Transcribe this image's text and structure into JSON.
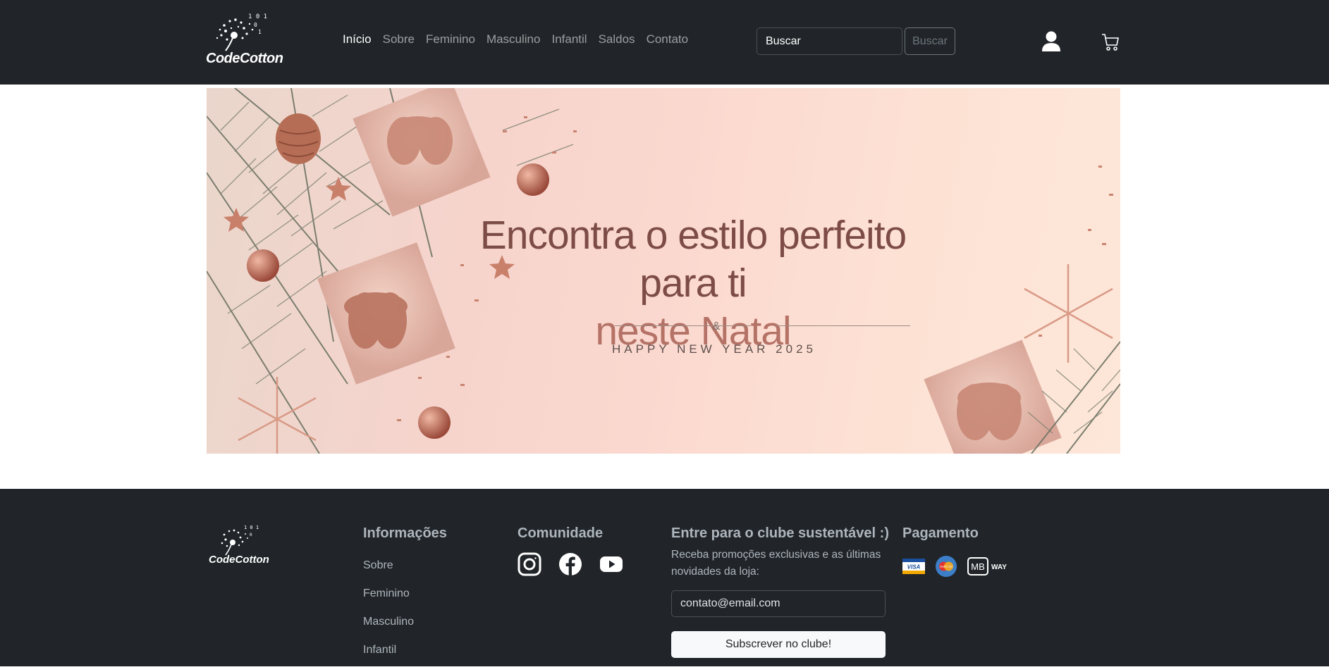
{
  "brand": {
    "name": "CodeCotton"
  },
  "nav": {
    "items": [
      {
        "label": "Início",
        "active": true
      },
      {
        "label": "Sobre"
      },
      {
        "label": "Feminino"
      },
      {
        "label": "Masculino"
      },
      {
        "label": "Infantil"
      },
      {
        "label": "Saldos"
      },
      {
        "label": "Contato"
      }
    ],
    "search_placeholder": "Buscar",
    "search_button": "Buscar",
    "user_icon": "user-icon",
    "cart_icon": "cart-icon"
  },
  "hero": {
    "headline_part1": "Encontra o estilo perfeito para ti",
    "headline_part2": "neste Natal",
    "ampersand": "&",
    "subline": "HAPPY NEW YEAR 2025"
  },
  "footer": {
    "info_heading": "Informações",
    "info_links": [
      "Sobre",
      "Feminino",
      "Masculino",
      "Infantil"
    ],
    "community_heading": "Comunidade",
    "social_icons": [
      "instagram-icon",
      "facebook-icon",
      "youtube-icon"
    ],
    "club_heading": "Entre para o clube sustentável :)",
    "club_text": "Receba promoções exclusivas e as últimas novidades da loja:",
    "club_placeholder": "contato@email.com",
    "club_button": "Subscrever no clube!",
    "payment_heading": "Pagamento",
    "payment_methods": [
      "VISA",
      "MasterCard",
      "MB",
      "WAY"
    ]
  },
  "colors": {
    "navbar_bg": "#212529",
    "nav_active": "#ffffff",
    "nav_inactive": "#9a9da0",
    "hero_text": "#b57266"
  }
}
